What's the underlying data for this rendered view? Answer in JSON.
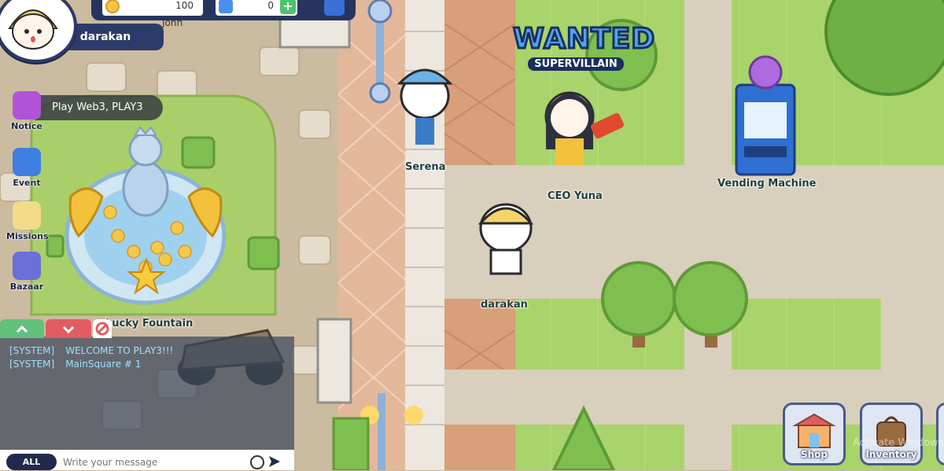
{
  "hud": {
    "player_name": "darakan",
    "coins": "100",
    "gems": "0",
    "plus_label": "+",
    "partial_name_behind": "John"
  },
  "menu": {
    "notice_label": "Notice",
    "notice_text": "Play Web3, PLAY3",
    "event_label": "Event",
    "missions_label": "Missions",
    "bazaar_label": "Bazaar"
  },
  "world": {
    "fountain_label": "Lucky Fountain",
    "npc_serena": "Serena",
    "npc_ceo": "CEO Yuna",
    "vending_label": "Vending Machine",
    "player_label": "darakan",
    "wanted_title": "WANTED",
    "wanted_sub": "SUPERVILLAIN"
  },
  "chat": {
    "lines": [
      {
        "tag": "[SYSTEM]",
        "msg": "WELCOME TO PLAY3!!!"
      },
      {
        "tag": "[SYSTEM]",
        "msg": "MainSquare # 1"
      }
    ],
    "channel_label": "ALL",
    "input_placeholder": "Write your message"
  },
  "buttons": {
    "shop_label": "Shop",
    "inventory_label": "Inventory"
  },
  "watermark": "Activate Windows",
  "colors": {
    "hud_navy": "#2d3b6a",
    "grass": "#a9d36b",
    "path": "#d8cfbd",
    "brick": "#d79f7a"
  }
}
